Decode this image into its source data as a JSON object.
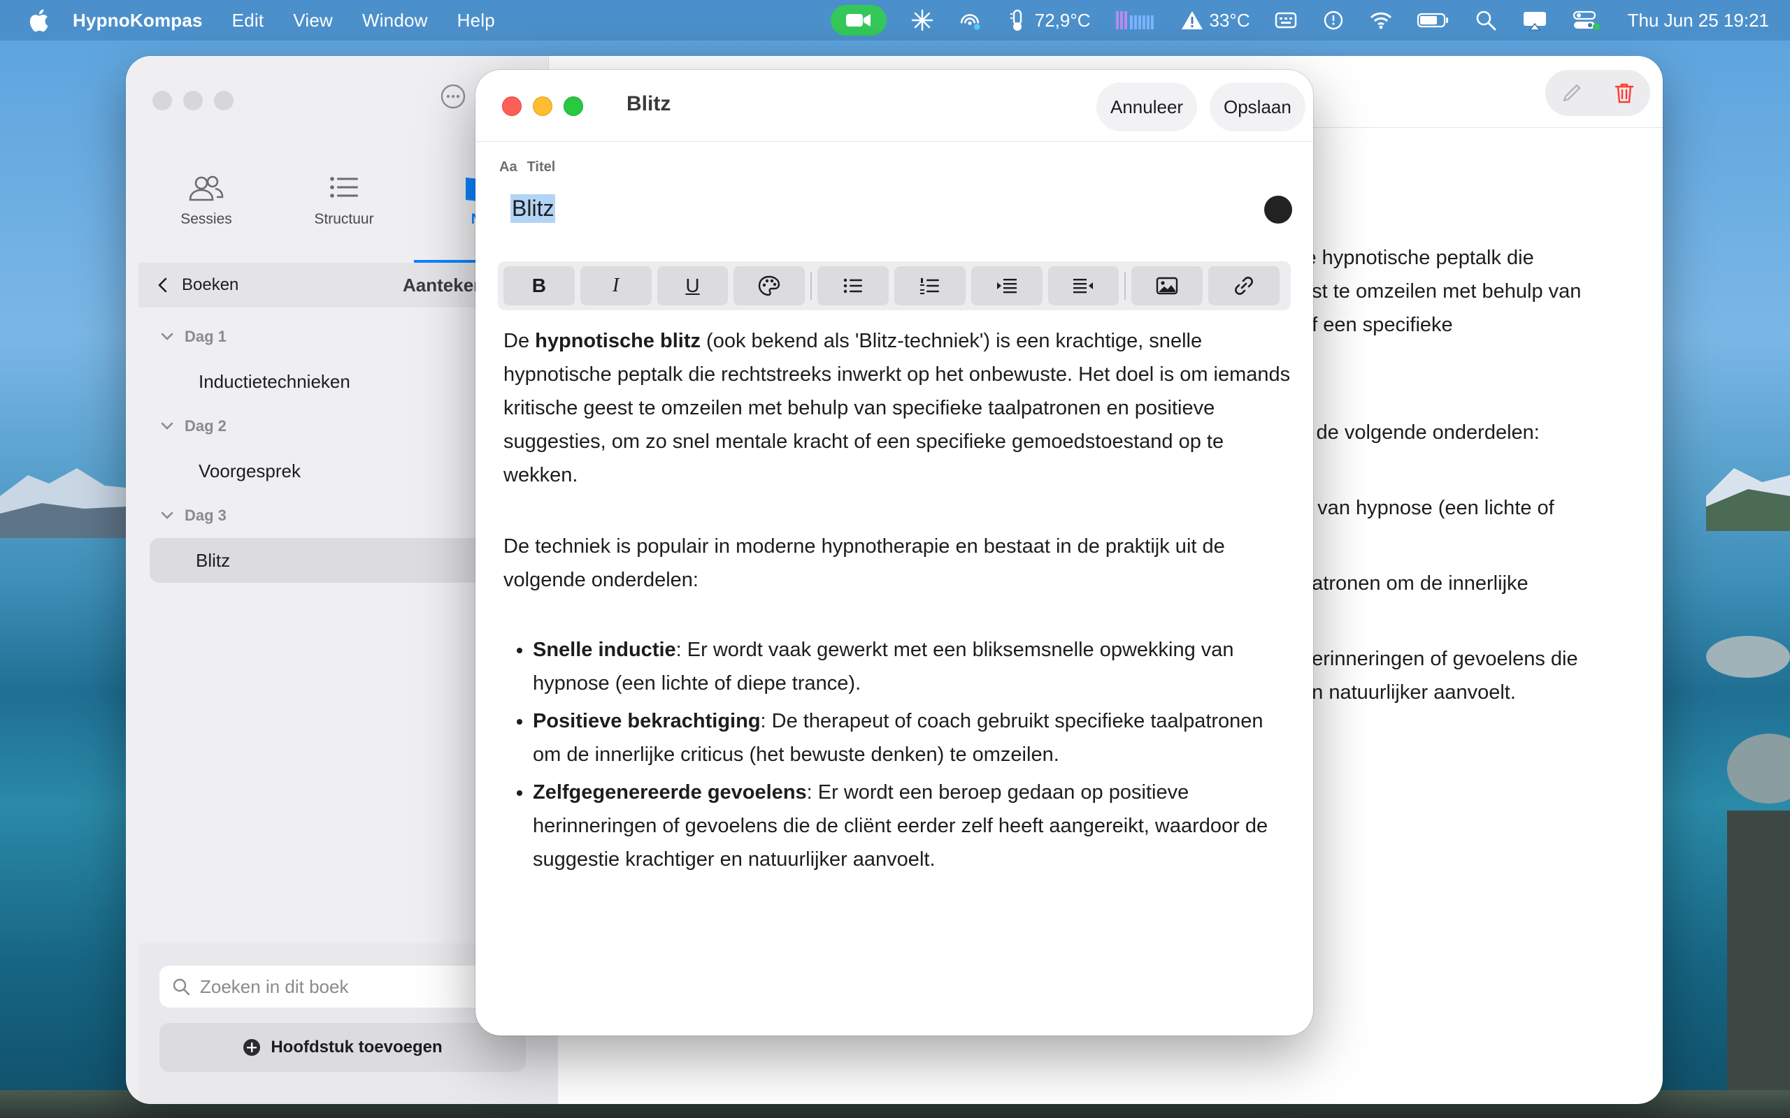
{
  "menubar": {
    "app_name": "HypnoKompas",
    "menus": [
      "Edit",
      "View",
      "Window",
      "Help"
    ],
    "temperature_cpu": "72,9°C",
    "temperature_alert": "33°C",
    "datetime": "Thu Jun 25  19:21"
  },
  "sidebar": {
    "tabs": [
      {
        "label": "Sessies",
        "icon": "people-icon"
      },
      {
        "label": "Structuur",
        "icon": "list-icon"
      },
      {
        "label": "Na",
        "icon": "book-icon"
      }
    ],
    "back_label": "Boeken",
    "header_title": "Aanteken",
    "days": [
      {
        "label": "Dag 1",
        "chapters": [
          "Inductietechnieken"
        ]
      },
      {
        "label": "Dag 2",
        "chapters": [
          "Voorgesprek"
        ]
      },
      {
        "label": "Dag 3",
        "chapters": [
          "Blitz"
        ]
      }
    ],
    "selected_chapter": "Blitz",
    "search_placeholder": "Zoeken in dit boek",
    "add_chapter_label": "Hoofdstuk toevoegen"
  },
  "background_content": {
    "lines": [
      "le hypnotische peptalk die",
      "est te omzeilen met behulp van",
      "of een specifieke",
      "",
      "",
      "it de volgende onderdelen:",
      "",
      "g van hypnose (een lichte of",
      "",
      "patronen om de innerlijke",
      "",
      "herinneringen of gevoelens die",
      "en natuurlijker aanvoelt."
    ]
  },
  "editor": {
    "window_title": "Blitz",
    "cancel_label": "Annuleer",
    "save_label": "Opslaan",
    "format_aa": "Aa",
    "format_style": "Titel",
    "title_value": "Blitz",
    "accent_color": "#222222",
    "toolbar": {
      "bold": "B",
      "italic": "I",
      "underline": "U"
    },
    "para1_pre": "De ",
    "para1_bold": "hypnotische blitz",
    "para1_post": " (ook bekend als 'Blitz-techniek') is een krachtige, snelle hypnotische peptalk die rechtstreeks inwerkt op het onbewuste. Het doel is om iemands kritische geest te omzeilen met behulp van specifieke taalpatronen en positieve suggesties, om zo snel mentale kracht of een specifieke gemoedstoestand op te wekken.",
    "para2": "De techniek is populair in moderne hypnotherapie en bestaat in de praktijk uit de volgende onderdelen:",
    "bullets": [
      {
        "bold": "Snelle inductie",
        "text": ": Er wordt vaak gewerkt met een bliksemsnelle opwekking van hypnose (een lichte of diepe trance)."
      },
      {
        "bold": "Positieve bekrachtiging",
        "text": ": De therapeut of coach gebruikt specifieke taalpatronen om de innerlijke criticus (het bewuste denken) te omzeilen."
      },
      {
        "bold": "Zelfgegenereerde gevoelens",
        "text": ": Er wordt een beroep gedaan op positieve herinneringen of gevoelens die de cliënt eerder zelf heeft aangereikt, waardoor de suggestie krachtiger en natuurlijker aanvoelt."
      }
    ]
  },
  "colors": {
    "accent_blue": "#0a84ff",
    "facetime_green": "#34c759",
    "delete_red": "#ff3b30"
  }
}
